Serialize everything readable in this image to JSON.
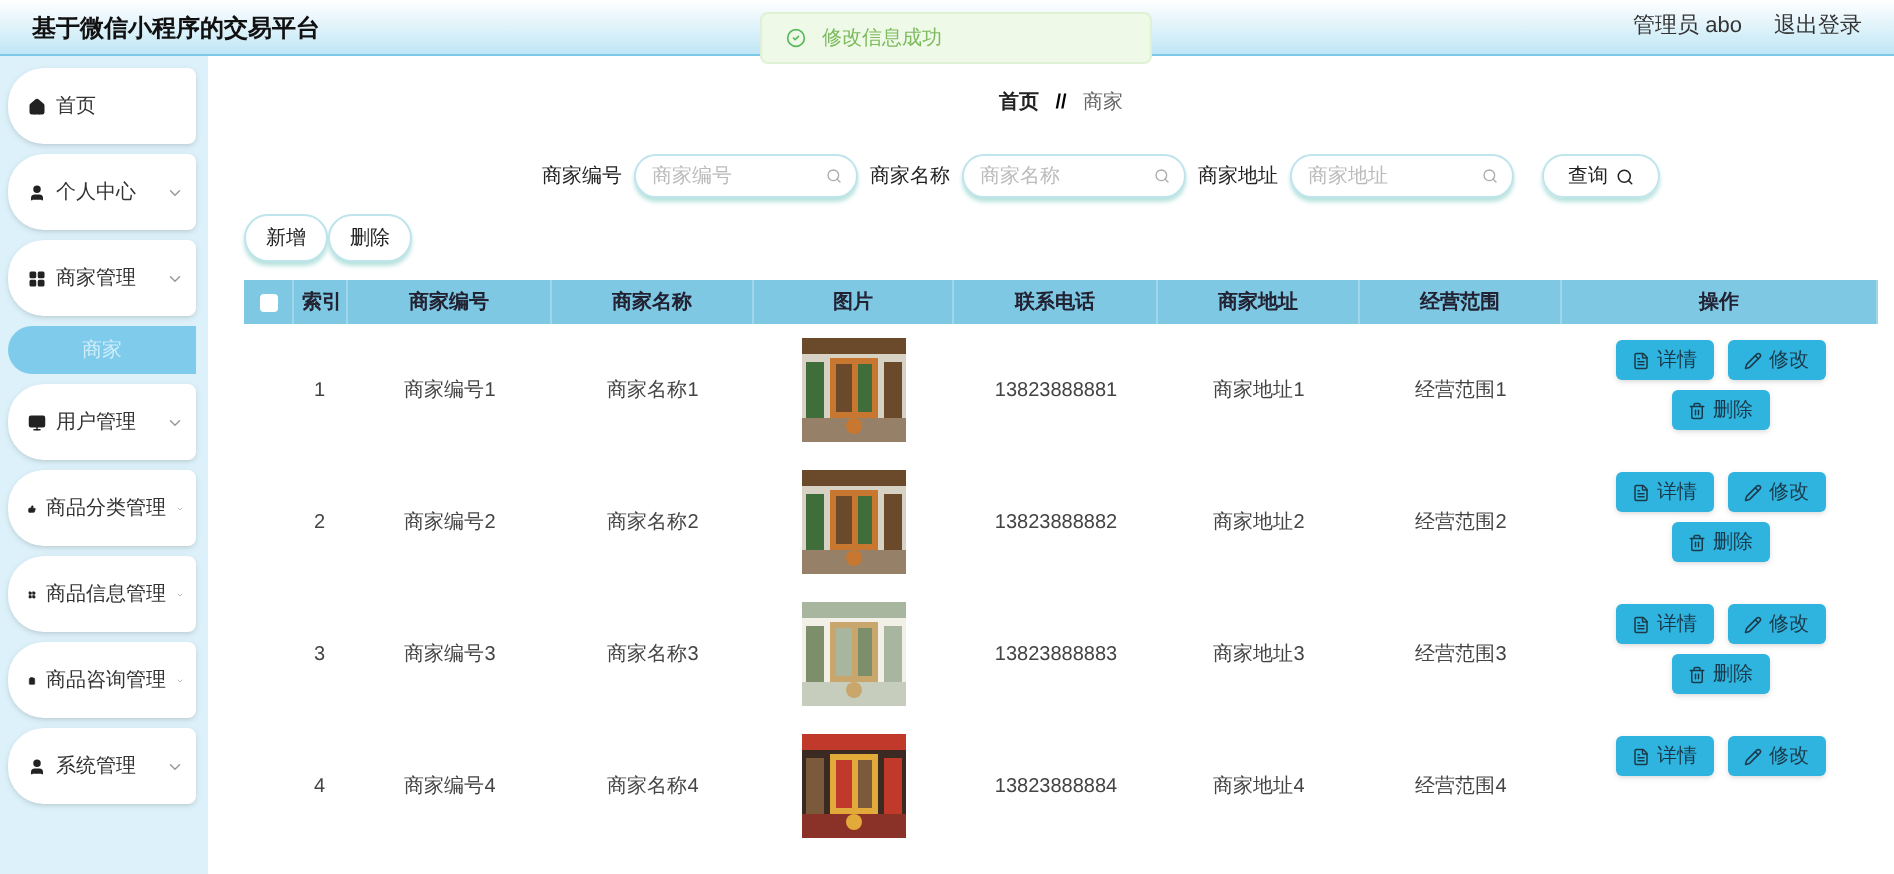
{
  "header": {
    "title": "基于微信小程序的交易平台",
    "user": "管理员 abo",
    "logout": "退出登录"
  },
  "toast": {
    "message": "修改信息成功"
  },
  "sidebar": {
    "items": [
      {
        "label": "首页",
        "kind": "link",
        "selected": false
      },
      {
        "label": "个人中心",
        "kind": "menu",
        "selected": false
      },
      {
        "label": "商家管理",
        "kind": "menu",
        "selected": false
      },
      {
        "label": "商家",
        "kind": "sub",
        "selected": true
      },
      {
        "label": "用户管理",
        "kind": "menu",
        "selected": false
      },
      {
        "label": "商品分类管理",
        "kind": "menu",
        "selected": false
      },
      {
        "label": "商品信息管理",
        "kind": "menu",
        "selected": false
      },
      {
        "label": "商品咨询管理",
        "kind": "menu",
        "selected": false
      },
      {
        "label": "系统管理",
        "kind": "menu",
        "selected": false
      }
    ]
  },
  "breadcrumb": {
    "home": "首页",
    "separator": "//",
    "current": "商家"
  },
  "search": {
    "fields": [
      {
        "label": "商家编号",
        "placeholder": "商家编号"
      },
      {
        "label": "商家名称",
        "placeholder": "商家名称"
      },
      {
        "label": "商家地址",
        "placeholder": "商家地址"
      }
    ],
    "button": "查询"
  },
  "toolbar": {
    "buttons": [
      "新增",
      "删除"
    ]
  },
  "table": {
    "select_all": {
      "checked": false
    },
    "columns": [
      "索引",
      "商家编号",
      "商家名称",
      "图片",
      "联系电话",
      "商家地址",
      "经营范围",
      "操作"
    ],
    "rows": [
      {
        "cells": [
          "1",
          "商家编号1",
          "商家名称1",
          {
            "kind": "picture"
          },
          "13823888881",
          "商家地址1",
          "经营范围1"
        ],
        "actions": [
          {
            "kind": "detail",
            "label": "详情"
          },
          {
            "kind": "edit",
            "label": "修改"
          },
          {
            "kind": "delete",
            "label": "删除"
          }
        ]
      },
      {
        "cells": [
          "2",
          "商家编号2",
          "商家名称2",
          {
            "kind": "picture"
          },
          "13823888882",
          "商家地址2",
          "经营范围2"
        ],
        "actions": [
          {
            "kind": "detail",
            "label": "详情"
          },
          {
            "kind": "edit",
            "label": "修改"
          },
          {
            "kind": "delete",
            "label": "删除"
          }
        ]
      },
      {
        "cells": [
          "3",
          "商家编号3",
          "商家名称3",
          {
            "kind": "picture"
          },
          "13823888883",
          "商家地址3",
          "经营范围3"
        ],
        "actions": [
          {
            "kind": "detail",
            "label": "详情"
          },
          {
            "kind": "edit",
            "label": "修改"
          },
          {
            "kind": "delete",
            "label": "删除"
          }
        ]
      },
      {
        "cells": [
          "4",
          "商家编号4",
          "商家名称4",
          {
            "kind": "picture"
          },
          "13823888884",
          "商家地址4",
          "经营范围4"
        ],
        "actions": [
          {
            "kind": "detail",
            "label": "详情"
          },
          {
            "kind": "edit",
            "label": "修改"
          }
        ]
      }
    ]
  }
}
